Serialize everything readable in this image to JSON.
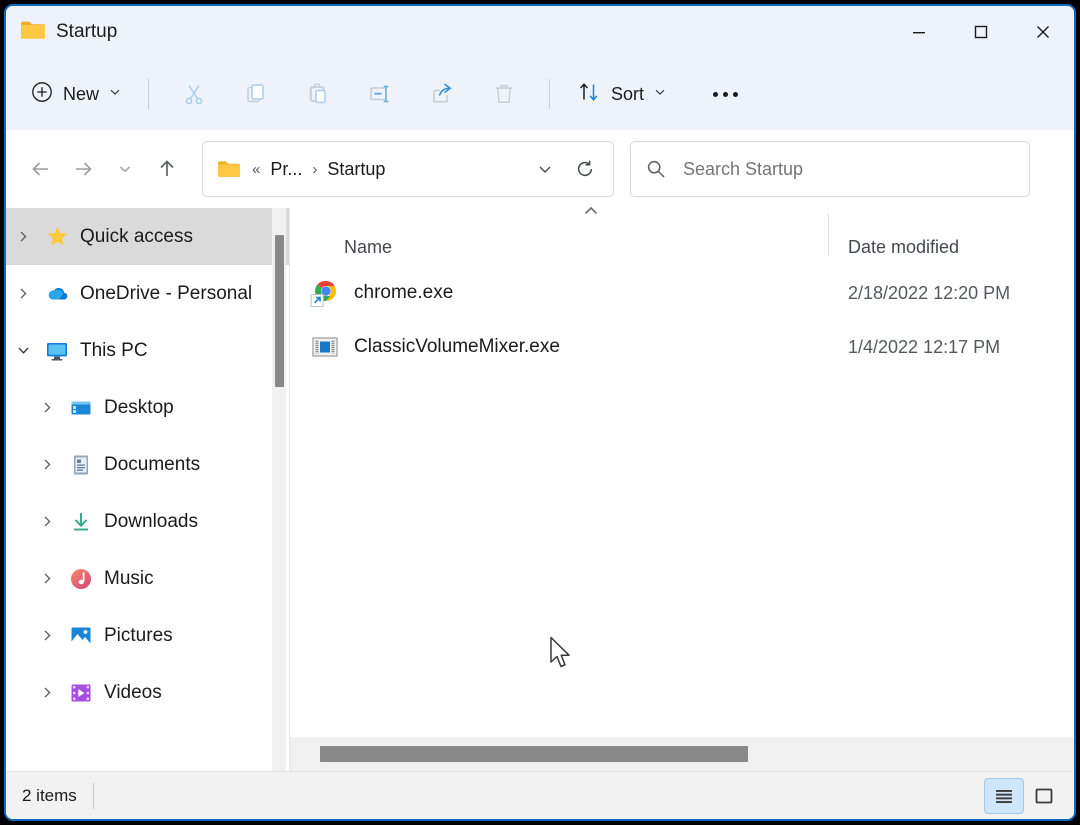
{
  "window": {
    "title": "Startup",
    "folder_icon": "folder-icon",
    "controls": {
      "minimize": "minimize-icon",
      "maximize": "maximize-icon",
      "close": "close-icon"
    }
  },
  "toolbar": {
    "new_label": "New",
    "new_icon": "plus-circle-icon",
    "new_chevron": "chevron-down-icon",
    "cut_icon": "scissors-icon",
    "copy_icon": "copy-icon",
    "paste_icon": "clipboard-icon",
    "rename_icon": "rename-icon",
    "share_icon": "share-icon",
    "delete_icon": "trash-icon",
    "sort_label": "Sort",
    "sort_icon": "sort-arrows-icon",
    "sort_chevron": "chevron-down-icon",
    "more_label": "See more",
    "more_icon": "ellipsis-icon"
  },
  "navigation": {
    "back_icon": "arrow-left-icon",
    "forward_icon": "arrow-right-icon",
    "recent_icon": "chevron-down-icon",
    "up_icon": "arrow-up-icon",
    "breadcrumb": {
      "folder_icon": "folder-icon",
      "overflow": "«",
      "items": [
        "Pr...",
        "Startup"
      ],
      "separator": "›",
      "dropdown_icon": "chevron-down-icon",
      "refresh_icon": "refresh-icon"
    }
  },
  "search": {
    "icon": "search-icon",
    "placeholder": "Search Startup",
    "value": ""
  },
  "sidebar": {
    "items": [
      {
        "label": "Quick access",
        "icon": "star-icon",
        "expanded": false,
        "selected": true,
        "indent": 0
      },
      {
        "label": "OneDrive - Personal",
        "icon": "onedrive-cloud-icon",
        "expanded": false,
        "selected": false,
        "indent": 0
      },
      {
        "label": "This PC",
        "icon": "monitor-icon",
        "expanded": true,
        "selected": false,
        "indent": 0
      },
      {
        "label": "Desktop",
        "icon": "desktop-icon",
        "expanded": false,
        "selected": false,
        "indent": 1
      },
      {
        "label": "Documents",
        "icon": "documents-icon",
        "expanded": false,
        "selected": false,
        "indent": 1
      },
      {
        "label": "Downloads",
        "icon": "downloads-icon",
        "expanded": false,
        "selected": false,
        "indent": 1
      },
      {
        "label": "Music",
        "icon": "music-icon",
        "expanded": false,
        "selected": false,
        "indent": 1
      },
      {
        "label": "Pictures",
        "icon": "pictures-icon",
        "expanded": false,
        "selected": false,
        "indent": 1
      },
      {
        "label": "Videos",
        "icon": "videos-icon",
        "expanded": false,
        "selected": false,
        "indent": 1
      }
    ]
  },
  "filelist": {
    "sort_indicator": "chevron-up-icon",
    "columns": [
      {
        "label": "Name",
        "key": "name"
      },
      {
        "label": "Date modified",
        "key": "date"
      }
    ],
    "rows": [
      {
        "name": "chrome.exe",
        "date": "2/18/2022 12:20 PM",
        "icon": "chrome-shortcut-icon"
      },
      {
        "name": "ClassicVolumeMixer.exe",
        "date": "1/4/2022 12:17 PM",
        "icon": "application-window-icon"
      }
    ]
  },
  "statusbar": {
    "item_count": "2 items",
    "views": [
      {
        "name": "details-view",
        "icon": "details-view-icon",
        "active": true
      },
      {
        "name": "large-icons-view",
        "icon": "large-icons-view-icon",
        "active": false
      }
    ]
  },
  "colors": {
    "accent": "#0f6cbd",
    "titlebar_bg": "#eef3fb",
    "selection_bg": "#dadada",
    "folder_yellow": "#ffc843",
    "scrollbar_thumb": "#888888"
  }
}
